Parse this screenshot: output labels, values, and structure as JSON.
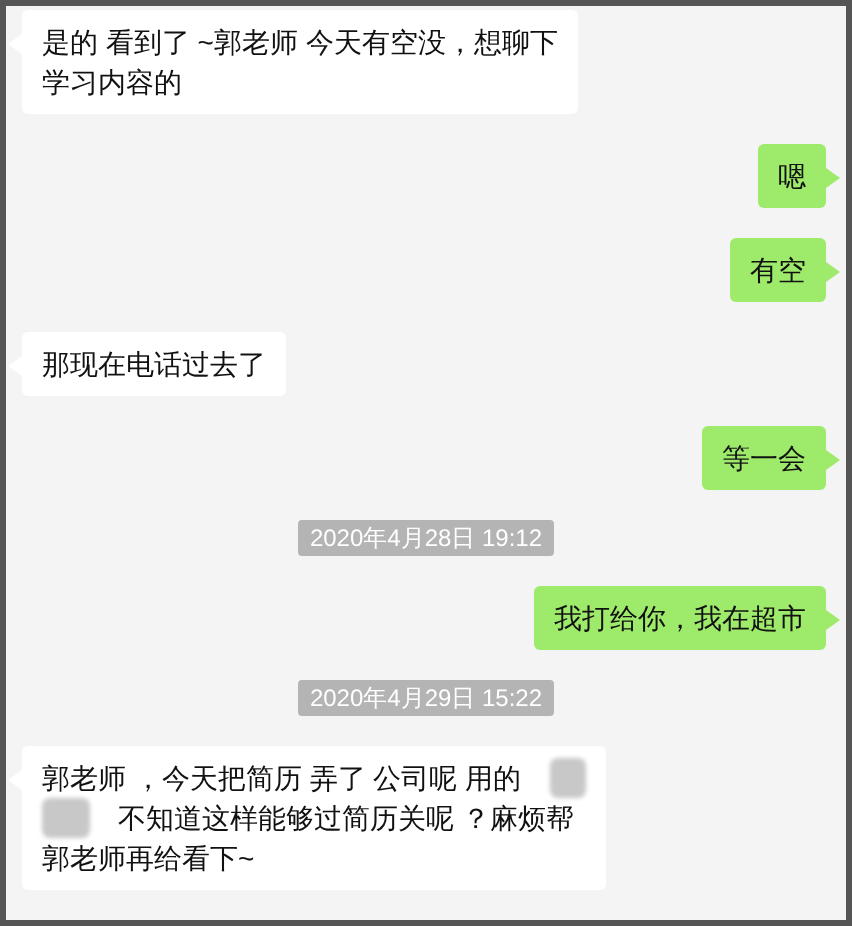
{
  "messages": [
    {
      "kind": "message",
      "outgoing": false,
      "lines": [
        {
          "text": "是的 看到了 ~郭老师 今天有空没，想聊下"
        },
        {
          "text": "学习内容的"
        }
      ]
    },
    {
      "kind": "message",
      "outgoing": true,
      "lines": [
        {
          "text": "嗯"
        }
      ]
    },
    {
      "kind": "message",
      "outgoing": true,
      "lines": [
        {
          "text": "有空"
        }
      ]
    },
    {
      "kind": "message",
      "outgoing": false,
      "lines": [
        {
          "text": "那现在电话过去了"
        }
      ]
    },
    {
      "kind": "message",
      "outgoing": true,
      "lines": [
        {
          "text": "等一会"
        }
      ]
    },
    {
      "kind": "time",
      "text": "2020年4月28日 19:12"
    },
    {
      "kind": "message",
      "outgoing": true,
      "lines": [
        {
          "text": "我打给你，我在超市"
        }
      ]
    },
    {
      "kind": "time",
      "text": "2020年4月29日 15:22"
    },
    {
      "kind": "message",
      "outgoing": false,
      "lines": [
        {
          "text": "郭老师 ，今天把简历 弄了   公司呢  用的",
          "redacted_after": true
        },
        {
          "text": "不知道这样能够过简历关呢 ？麻烦帮",
          "redacted_before": true
        },
        {
          "text": "郭老师再给看下~"
        }
      ]
    }
  ]
}
